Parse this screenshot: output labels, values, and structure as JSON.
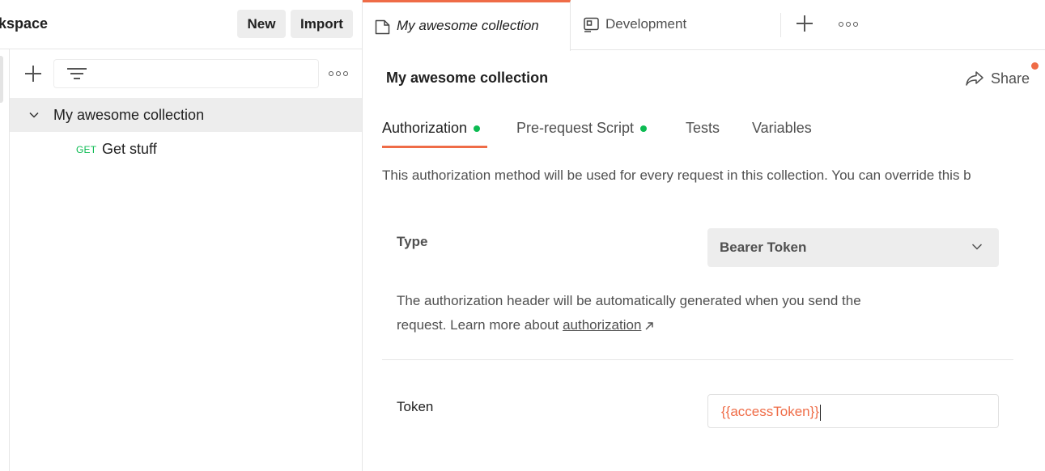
{
  "sidebar": {
    "workspace_title": "kspace",
    "new_label": "New",
    "import_label": "Import",
    "search_placeholder": "",
    "collection": {
      "name": "My awesome collection",
      "requests": [
        {
          "method": "GET",
          "name": "Get stuff"
        }
      ]
    }
  },
  "tabs": [
    {
      "label": "My awesome collection",
      "icon": "collection-icon",
      "active": true
    },
    {
      "label": "Development",
      "icon": "environment-icon",
      "active": false
    }
  ],
  "main": {
    "title": "My awesome collection",
    "share_label": "Share",
    "subtabs": [
      {
        "label": "Authorization",
        "has_dot": true,
        "active": true
      },
      {
        "label": "Pre-request Script",
        "has_dot": true,
        "active": false
      },
      {
        "label": "Tests",
        "has_dot": false,
        "active": false
      },
      {
        "label": "Variables",
        "has_dot": false,
        "active": false
      }
    ],
    "description": "This authorization method will be used for every request in this collection. You can override this b",
    "type_label": "Type",
    "type_value": "Bearer Token",
    "help_text_1": "The authorization header will be automatically generated when you send the",
    "help_text_2": "request. Learn more about ",
    "help_link": "authorization",
    "token_label": "Token",
    "token_value": "{{accessToken}}"
  },
  "colors": {
    "accent": "#ef6c47",
    "method_get": "#0cbb52",
    "status_dot": "#0cbb52"
  }
}
